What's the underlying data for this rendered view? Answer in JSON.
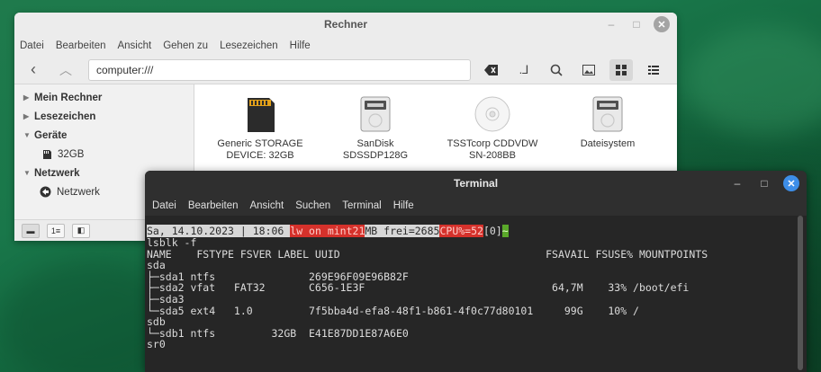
{
  "file_manager": {
    "title": "Rechner",
    "menu": [
      "Datei",
      "Bearbeiten",
      "Ansicht",
      "Gehen zu",
      "Lesezeichen",
      "Hilfe"
    ],
    "location": "computer:///",
    "sidebar": {
      "sections": [
        {
          "label": "Mein Rechner",
          "expanded": false,
          "items": []
        },
        {
          "label": "Lesezeichen",
          "expanded": false,
          "items": []
        },
        {
          "label": "Geräte",
          "expanded": true,
          "items": [
            {
              "label": "32GB",
              "icon": "sd-card-icon"
            }
          ]
        },
        {
          "label": "Netzwerk",
          "expanded": true,
          "items": [
            {
              "label": "Netzwerk",
              "icon": "network-icon"
            }
          ]
        }
      ]
    },
    "devices": [
      {
        "name": "Generic STORAGE DEVICE: 32GB",
        "icon": "sd-card-icon"
      },
      {
        "name": "SanDisk SDSSDP128G",
        "icon": "harddisk-icon"
      },
      {
        "name": "TSSTcorp CDDVDW SN-208BB",
        "icon": "optical-disc-icon"
      },
      {
        "name": "Dateisystem",
        "icon": "harddisk-icon"
      }
    ]
  },
  "terminal": {
    "title": "Terminal",
    "menu": [
      "Datei",
      "Bearbeiten",
      "Ansicht",
      "Suchen",
      "Terminal",
      "Hilfe"
    ],
    "prompt": {
      "date": "Sa, 14.10.2023",
      "sep": " | ",
      "time": "18:06",
      "user": "lw on mint21",
      "mem": "MB frei=2685",
      "cpu": "CPU%=52",
      "ret": "[0]",
      "tilde": "~"
    },
    "lines": [
      "lsblk -f",
      "NAME    FSTYPE FSVER LABEL UUID                                 FSAVAIL FSUSE% MOUNTPOINTS",
      "sda",
      "├─sda1 ntfs               269E96F09E96B82F",
      "├─sda2 vfat   FAT32       C656-1E3F                              64,7M    33% /boot/efi",
      "├─sda3",
      "└─sda5 ext4   1.0         7f5bba4d-efa8-48f1-b861-4f0c77d80101     99G    10% /",
      "sdb",
      "└─sdb1 ntfs         32GB  E41E87DD1E87A6E0",
      "sr0"
    ]
  }
}
